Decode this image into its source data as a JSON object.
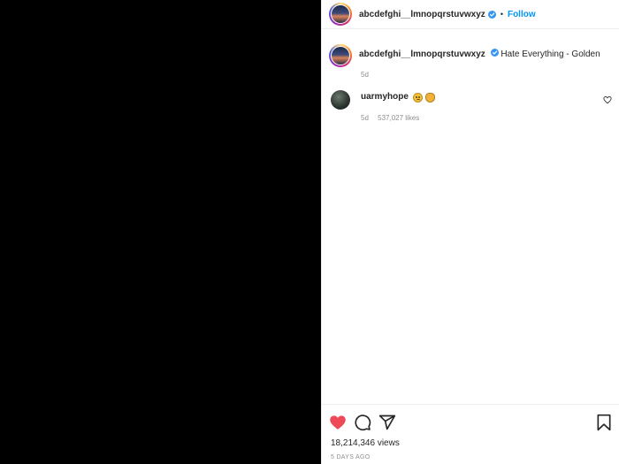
{
  "post": {
    "author": "abcdefghi__lmnopqrstuvwxyz",
    "follow_label": "Follow",
    "separator": "•",
    "caption_text": "Hate Everything - Golden",
    "caption_age": "5d",
    "views": "18,214,346 views",
    "posted": "5 DAYS AGO"
  },
  "comments": [
    {
      "username": "uarmyhope",
      "emojis": [
        "frowning-face-emoji",
        "clapping-hands-emoji"
      ],
      "age": "5d",
      "likes": "537,027 likes"
    }
  ],
  "icons": {
    "verified": "verified-badge-icon",
    "like_filled": "heart-filled-icon",
    "comment": "comment-icon",
    "share": "share-icon",
    "save": "bookmark-icon",
    "comment_like": "heart-outline-icon"
  },
  "colors": {
    "accent": "#0095f6",
    "like": "#ed4956",
    "verified": "#3897f0",
    "muted": "#8e8e8e",
    "text": "#262626",
    "media_bg": "#000000"
  }
}
